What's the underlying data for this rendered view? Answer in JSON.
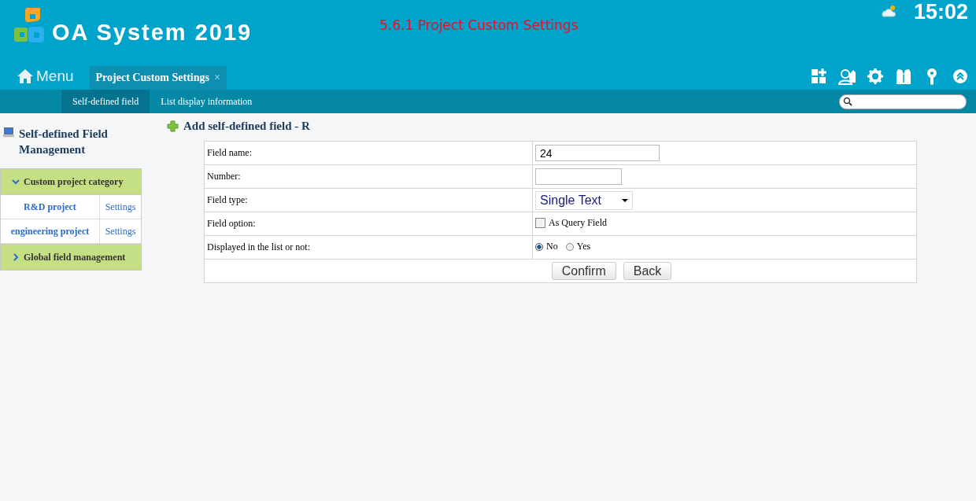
{
  "header": {
    "app_title": "OA System 2019",
    "annotation": "5.6.1 Project Custom Settings",
    "clock": "15:02"
  },
  "nav": {
    "menu_label": "Menu",
    "tabs": [
      {
        "label": "Project Custom Settings",
        "close": "×",
        "selected": true
      }
    ]
  },
  "subnav": {
    "items": [
      {
        "label": "Self-defined field",
        "selected": true
      },
      {
        "label": "List display information",
        "selected": false
      }
    ]
  },
  "sidebar": {
    "title": "Self-defined Field Management",
    "groups": [
      {
        "label": "Custom project category",
        "expanded": true,
        "items": [
          {
            "name": "R&D project",
            "action": "Settings"
          },
          {
            "name": "engineering project",
            "action": "Settings"
          }
        ]
      },
      {
        "label": "Global field management",
        "expanded": false
      }
    ]
  },
  "form": {
    "title": "Add self-defined field - R",
    "rows": [
      {
        "kind": "text",
        "label": "Field name:",
        "value": "24"
      },
      {
        "kind": "text",
        "label": "Number:"
      },
      {
        "kind": "select",
        "label": "Field type:",
        "value": "Single Text"
      },
      {
        "kind": "checkbox",
        "label": "Field option:",
        "option": "As Query Field",
        "checked": false
      },
      {
        "kind": "radio",
        "label": "Displayed in the list or not:",
        "options": [
          {
            "label": "No",
            "selected": true
          },
          {
            "label": "Yes",
            "selected": false
          }
        ]
      }
    ],
    "buttons": [
      "Confirm",
      "Back"
    ]
  }
}
